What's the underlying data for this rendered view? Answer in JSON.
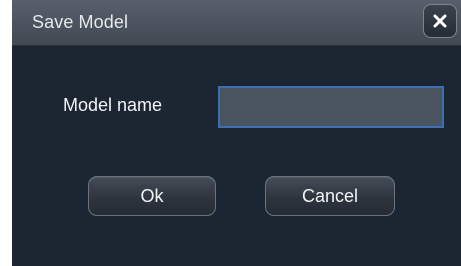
{
  "dialog": {
    "title": "Save Model",
    "close_icon": "close-icon",
    "field_label": "Model name",
    "model_name_value": "",
    "ok_label": "Ok",
    "cancel_label": "Cancel"
  },
  "colors": {
    "titlebar": "#4f5762",
    "body": "#1c2633",
    "input_fill": "#4a5360",
    "input_border": "#3d6fb3",
    "text": "#f2f4f6"
  }
}
